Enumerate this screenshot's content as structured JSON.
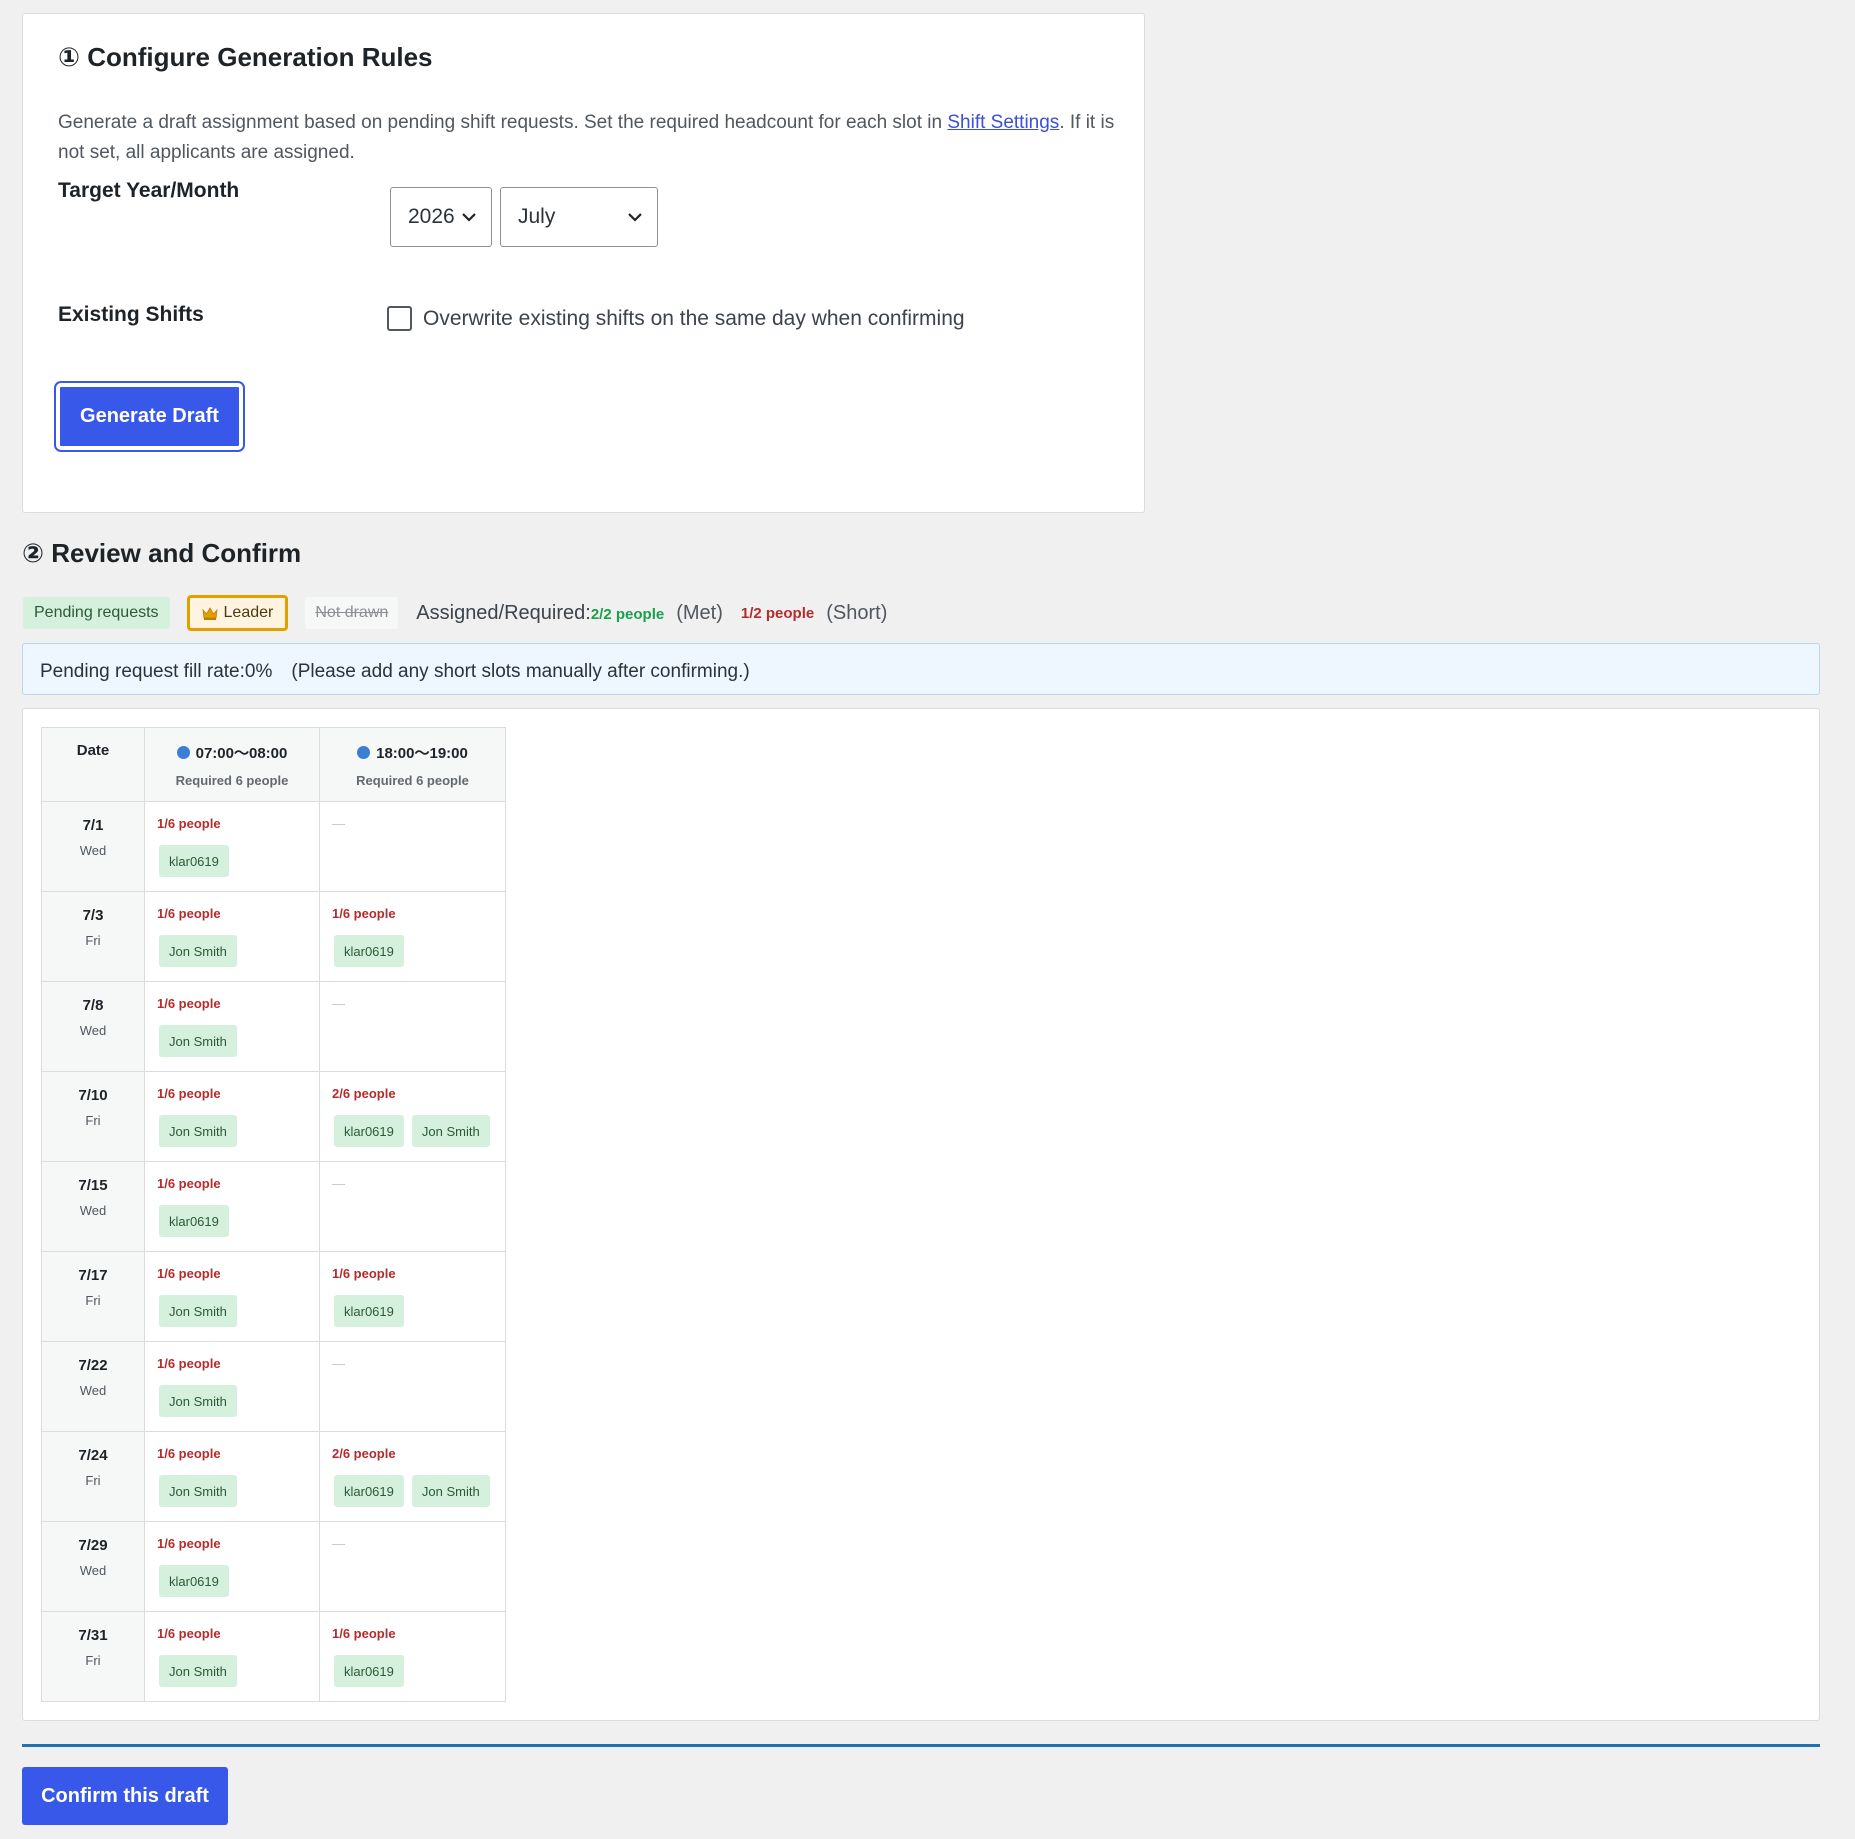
{
  "section1": {
    "title": "① Configure Generation Rules",
    "desc_before": "Generate a draft assignment based on pending shift requests. Set the required headcount for each slot in ",
    "desc_link": "Shift Settings",
    "desc_after": ". If it is not set, all applicants are assigned.",
    "target_label": "Target Year/Month",
    "year_value": "2026",
    "month_value": "July",
    "existing_label": "Existing Shifts",
    "overwrite_label": "Overwrite existing shifts on the same day when confirming",
    "generate_button": "Generate Draft"
  },
  "section2": {
    "title": "② Review and Confirm",
    "legend": {
      "pending": "Pending requests",
      "leader": "Leader",
      "not_drawn": "Not drawn",
      "assigned_label": "Assigned/Required:",
      "met_value": "2/2 people",
      "met_text": "(Met)",
      "short_value": "1/2 people",
      "short_text": "(Short)"
    },
    "notice": "Pending request fill rate:0%　(Please add any short slots manually after confirming.)",
    "table": {
      "date_header": "Date",
      "slots": [
        {
          "time": "07:00〜08:00",
          "required": "Required 6 people"
        },
        {
          "time": "18:00〜19:00",
          "required": "Required 6 people"
        }
      ],
      "rows": [
        {
          "date": "7/1",
          "weekday": "Wed",
          "s1_count": "1/6 people",
          "s1_names": [
            "klar0619"
          ],
          "s2_count": "—",
          "s2_names": []
        },
        {
          "date": "7/3",
          "weekday": "Fri",
          "s1_count": "1/6 people",
          "s1_names": [
            "Jon Smith"
          ],
          "s2_count": "1/6 people",
          "s2_names": [
            "klar0619"
          ]
        },
        {
          "date": "7/8",
          "weekday": "Wed",
          "s1_count": "1/6 people",
          "s1_names": [
            "Jon Smith"
          ],
          "s2_count": "—",
          "s2_names": []
        },
        {
          "date": "7/10",
          "weekday": "Fri",
          "s1_count": "1/6 people",
          "s1_names": [
            "Jon Smith"
          ],
          "s2_count": "2/6 people",
          "s2_names": [
            "klar0619",
            "Jon Smith"
          ]
        },
        {
          "date": "7/15",
          "weekday": "Wed",
          "s1_count": "1/6 people",
          "s1_names": [
            "klar0619"
          ],
          "s2_count": "—",
          "s2_names": []
        },
        {
          "date": "7/17",
          "weekday": "Fri",
          "s1_count": "1/6 people",
          "s1_names": [
            "Jon Smith"
          ],
          "s2_count": "1/6 people",
          "s2_names": [
            "klar0619"
          ]
        },
        {
          "date": "7/22",
          "weekday": "Wed",
          "s1_count": "1/6 people",
          "s1_names": [
            "Jon Smith"
          ],
          "s2_count": "—",
          "s2_names": []
        },
        {
          "date": "7/24",
          "weekday": "Fri",
          "s1_count": "1/6 people",
          "s1_names": [
            "Jon Smith"
          ],
          "s2_count": "2/6 people",
          "s2_names": [
            "klar0619",
            "Jon Smith"
          ]
        },
        {
          "date": "7/29",
          "weekday": "Wed",
          "s1_count": "1/6 people",
          "s1_names": [
            "klar0619"
          ],
          "s2_count": "—",
          "s2_names": []
        },
        {
          "date": "7/31",
          "weekday": "Fri",
          "s1_count": "1/6 people",
          "s1_names": [
            "Jon Smith"
          ],
          "s2_count": "1/6 people",
          "s2_names": [
            "klar0619"
          ]
        }
      ]
    },
    "confirm_button": "Confirm this draft"
  },
  "colors": {
    "primary": "#3858e9",
    "short": "#b32d2e",
    "met": "#1a9f4a",
    "chip_bg": "#d5f0dc",
    "slot_dot": "#3b7fd4"
  }
}
